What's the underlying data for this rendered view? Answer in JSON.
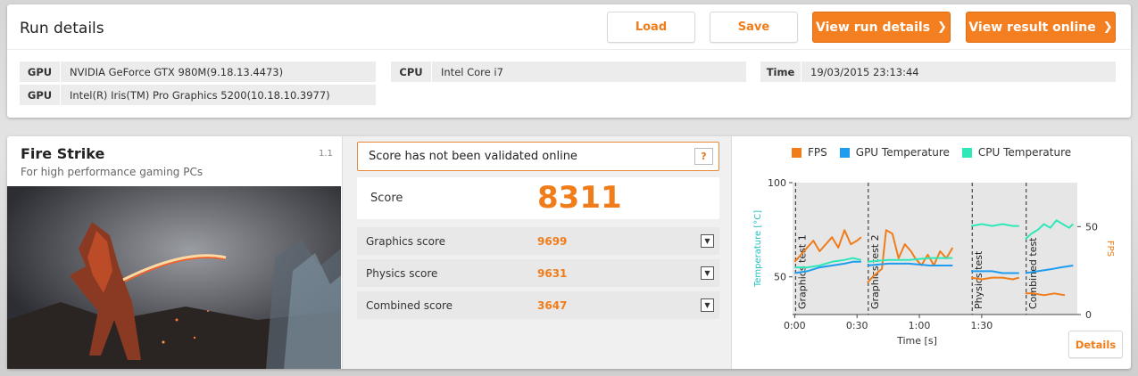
{
  "run": {
    "title": "Run details",
    "load_label": "Load",
    "save_label": "Save",
    "view_details_label": "View run details",
    "view_online_label": "View result online",
    "chevron": "❯"
  },
  "info": {
    "gpu_key": "GPU",
    "gpu1": "NVIDIA GeForce GTX 980M(9.18.13.4473)",
    "gpu2": "Intel(R) Iris(TM) Pro Graphics 5200(10.18.10.3977)",
    "cpu_key": "CPU",
    "cpu": "Intel Core i7",
    "time_key": "Time",
    "time": "19/03/2015 23:13:44"
  },
  "benchmark": {
    "name": "Fire Strike",
    "subtitle": "For high performance gaming PCs",
    "version": "1.1"
  },
  "validation": {
    "message": "Score has not been validated online",
    "help": "?"
  },
  "score": {
    "label": "Score",
    "value": "8311",
    "rows": [
      {
        "label": "Graphics score",
        "value": "9699"
      },
      {
        "label": "Physics score",
        "value": "9631"
      },
      {
        "label": "Combined score",
        "value": "3647"
      }
    ],
    "expand_icon": "▼"
  },
  "colors": {
    "accent": "#f37f20",
    "fps": "#f07c1a",
    "gpu_temp": "#1e9df0",
    "cpu_temp": "#2ee8b8",
    "temp_axis": "#22c0c0"
  },
  "chart_data": {
    "type": "line",
    "series": [
      {
        "name": "FPS",
        "color": "#f07c1a",
        "axis": "right",
        "segments": [
          [
            [
              0,
              30
            ],
            [
              3,
              34
            ],
            [
              6,
              38
            ],
            [
              9,
              42
            ],
            [
              12,
              36
            ],
            [
              15,
              40
            ],
            [
              18,
              44
            ],
            [
              21,
              38
            ],
            [
              24,
              48
            ],
            [
              27,
              40
            ],
            [
              30,
              42
            ],
            [
              32,
              44
            ]
          ],
          [
            [
              35,
              18
            ],
            [
              38,
              22
            ],
            [
              42,
              26
            ],
            [
              44,
              48
            ],
            [
              47,
              46
            ],
            [
              50,
              32
            ],
            [
              53,
              40
            ],
            [
              56,
              36
            ],
            [
              58,
              32
            ],
            [
              61,
              28
            ],
            [
              64,
              34
            ],
            [
              67,
              28
            ],
            [
              70,
              36
            ],
            [
              73,
              32
            ],
            [
              76,
              38
            ]
          ],
          [
            [
              85,
              21
            ],
            [
              90,
              20
            ],
            [
              95,
              21
            ],
            [
              100,
              21
            ],
            [
              105,
              20
            ],
            [
              108,
              21
            ]
          ],
          [
            [
              111,
              12
            ],
            [
              115,
              12
            ],
            [
              120,
              11
            ],
            [
              125,
              12
            ],
            [
              130,
              11
            ]
          ]
        ]
      },
      {
        "name": "GPU Temperature",
        "color": "#1e9df0",
        "axis": "left",
        "segments": [
          [
            [
              0,
              52
            ],
            [
              6,
              53
            ],
            [
              12,
              55
            ],
            [
              18,
              56
            ],
            [
              24,
              57
            ],
            [
              28,
              58
            ],
            [
              32,
              58
            ]
          ],
          [
            [
              35,
              56
            ],
            [
              45,
              57
            ],
            [
              55,
              57
            ],
            [
              65,
              56
            ],
            [
              76,
              56
            ]
          ],
          [
            [
              85,
              53
            ],
            [
              95,
              53
            ],
            [
              100,
              52
            ],
            [
              108,
              52
            ]
          ],
          [
            [
              111,
              52
            ],
            [
              117,
              53
            ],
            [
              123,
              54
            ],
            [
              128,
              55
            ],
            [
              134,
              56
            ]
          ]
        ]
      },
      {
        "name": "CPU Temperature",
        "color": "#2ee8b8",
        "axis": "left",
        "segments": [
          [
            [
              0,
              55
            ],
            [
              6,
              55
            ],
            [
              12,
              56
            ],
            [
              18,
              58
            ],
            [
              24,
              59
            ],
            [
              28,
              60
            ],
            [
              32,
              59
            ]
          ],
          [
            [
              35,
              58
            ],
            [
              45,
              59
            ],
            [
              55,
              59
            ],
            [
              65,
              60
            ],
            [
              76,
              60
            ]
          ],
          [
            [
              85,
              77
            ],
            [
              90,
              78
            ],
            [
              95,
              77
            ],
            [
              100,
              78
            ],
            [
              105,
              77
            ],
            [
              108,
              77
            ]
          ],
          [
            [
              111,
              70
            ],
            [
              114,
              73
            ],
            [
              117,
              75
            ],
            [
              120,
              78
            ],
            [
              123,
              76
            ],
            [
              126,
              80
            ],
            [
              129,
              78
            ],
            [
              132,
              76
            ],
            [
              134,
              78
            ]
          ]
        ]
      }
    ],
    "sections": [
      {
        "label": "Graphics test 1",
        "start": 0,
        "end": 32
      },
      {
        "label": "Graphics test 2",
        "start": 35,
        "end": 76
      },
      {
        "label": "Physics test",
        "start": 85,
        "end": 108
      },
      {
        "label": "Combined test",
        "start": 111,
        "end": 134
      }
    ],
    "xlabel": "Time [s]",
    "ylabel_left": "Temperature [°C]",
    "ylabel_right": "FPS",
    "x_ticks": [
      {
        "v": 0,
        "label": "0:00"
      },
      {
        "v": 30,
        "label": "0:30"
      },
      {
        "v": 60,
        "label": "1:00"
      },
      {
        "v": 90,
        "label": "1:30"
      }
    ],
    "y_left_ticks": [
      {
        "v": 50,
        "label": "50"
      },
      {
        "v": 100,
        "label": "100"
      }
    ],
    "y_right_ticks": [
      {
        "v": 0,
        "label": "0"
      },
      {
        "v": 50,
        "label": "50"
      }
    ],
    "xlim": [
      -1,
      136
    ],
    "ylim_left": [
      30,
      100
    ],
    "ylim_right": [
      0,
      75
    ],
    "details_label": "Details"
  }
}
